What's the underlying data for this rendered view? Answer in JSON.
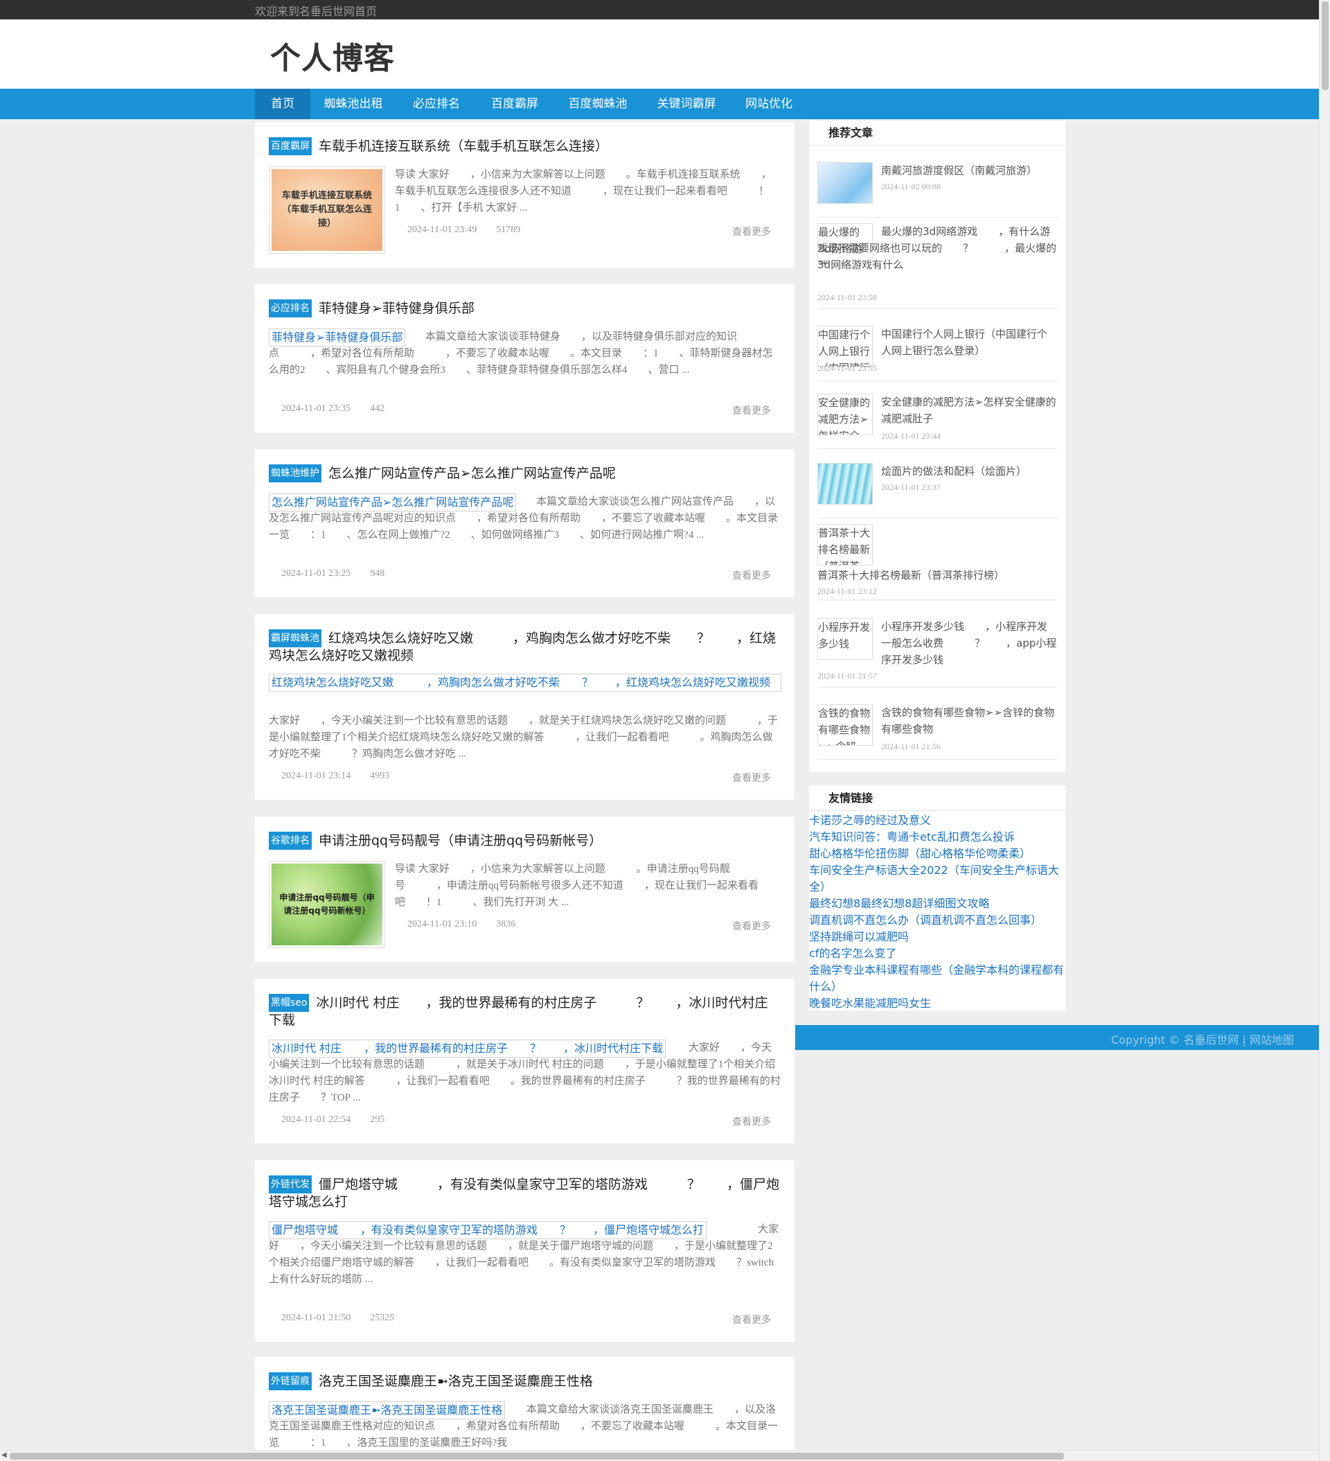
{
  "topbar": {
    "welcome": "欢迎来到名垂后世网首页"
  },
  "header": {
    "site_title": "个人博客"
  },
  "nav": [
    "首页",
    "蜘蛛池出租",
    "必应排名",
    "百度霸屏",
    "百度蜘蛛池",
    "关键词霸屏",
    "网站优化"
  ],
  "more_label": "查看更多",
  "posts": [
    {
      "category": "百度霸屏",
      "title": "车载手机连接互联系统（车载手机互联怎么连接）",
      "thumb_text": "车载手机连接互联系统（车载手机互联怎么连接）",
      "excerpt": "导读 大家好　　，小信来为大家解答以上问题　　。车载手机连接互联系统　　，车载手机互联怎么连接很多人还不知道　　　，现在让我们一起来看看吧　　　！1　　、打开【手机 大家好 ...",
      "date": "2024-11-01 23:49",
      "views": "51789"
    },
    {
      "category": "必应排名",
      "title": "菲特健身➢菲特健身俱乐部",
      "alt": "菲特健身➢菲特健身俱乐部",
      "excerpt": "本篇文章给大家谈谈菲特健身　　，以及菲特健身俱乐部对应的知识点　　　，希望对各位有所帮助　　　，不要忘了收藏本站喔　　。本文目录　　：1　　、菲特斯健身器材怎么用的2　　、宾阳县有几个健身会所3　　、菲特健身菲特健身俱乐部怎么样4　　、营口 ...",
      "date": "2024-11-01 23:35",
      "views": "442"
    },
    {
      "category": "蜘蛛池维护",
      "title": "怎么推广网站宣传产品➢怎么推广网站宣传产品呢",
      "alt": "怎么推广网站宣传产品➢怎么推广网站宣传产品呢",
      "excerpt": "本篇文章给大家谈谈怎么推广网站宣传产品　　，以及怎么推广网站宣传产品呢对应的知识点　　，希望对各位有所帮助　　，不要忘了收藏本站喔　　。本文目录一览　　：1　　、怎么在网上做推广?2　　、如何做网络推广3　　、如何进行网站推广啊?4 ...",
      "date": "2024-11-01 23:25",
      "views": "948"
    },
    {
      "category": "霸屏蜘蛛池",
      "title": "红烧鸡块怎么烧好吃又嫩　　　，鸡胸肉怎么做才好吃不柴　　？　　，红烧鸡块怎么烧好吃又嫩视频",
      "alt": "红烧鸡块怎么烧好吃又嫩　　　，鸡胸肉怎么做才好吃不柴　　？　　，红烧鸡块怎么烧好吃又嫩视频",
      "excerpt": "大家好　　，今天小编关注到一个比较有意思的话题　　，就是关于红烧鸡块怎么烧好吃又嫩的问题　　　，于是小编就整理了1个相关介绍红烧鸡块怎么烧好吃又嫩的解答　　　，让我们一起看看吧　　　。鸡胸肉怎么做才好吃不柴　　　？鸡胸肉怎么做才好吃 ...",
      "date": "2024-11-01 23:14",
      "views": "4993"
    },
    {
      "category": "谷歌排名",
      "title": "申请注册qq号码靓号（申请注册qq号码新帐号）",
      "thumb_text": "申请注册qq号码靓号（申请注册qq号码新帐号）",
      "excerpt": "导读 大家好　　，小信来为大家解答以上问题　　　。申请注册qq号码靓号　　　，申请注册qq号码新帐号很多人还不知道　　，现在让我们一起来看看吧　　！1　　　、我们先打开浏 大 ...",
      "date": "2024-11-01 23:10",
      "views": "3836"
    },
    {
      "category": "黑帽seo",
      "title": "冰川时代 村庄　　，我的世界最稀有的村庄房子　　　？　　，冰川时代村庄下载",
      "alt": "冰川时代 村庄　　，我的世界最稀有的村庄房子　　？　　，冰川时代村庄下载",
      "excerpt": "大家好　　，今天小编关注到一个比较有意思的话题　　　，就是关于冰川时代 村庄的问题　　，于是小编就整理了1个相关介绍冰川时代 村庄的解答　　　，让我们一起看看吧　　。我的世界最稀有的村庄房子　　　？我的世界最稀有的村庄房子　　？TOP ...",
      "date": "2024-11-01 22:54",
      "views": "295"
    },
    {
      "category": "外链代发",
      "title": "僵尸炮塔守城　　　，有没有类似皇家守卫军的塔防游戏　　　？　　，僵尸炮塔守城怎么打",
      "alt": "僵尸炮塔守城　　，有没有类似皇家守卫军的塔防游戏　　？　　，僵尸炮塔守城怎么打",
      "excerpt": "大家好　　，今天小编关注到一个比较有意思的话题　　，就是关于僵尸炮塔守城的问题　　，于是小编就整理了2个相关介绍僵尸炮塔守城的解答　　，让我们一起看看吧　　。有没有类似皇家守卫军的塔防游戏　　？switch上有什么好玩的塔防 ...",
      "date": "2024-11-01 21:50",
      "views": "25325"
    },
    {
      "category": "外链留痕",
      "title": "洛克王国圣诞麋鹿王➼洛克王国圣诞麋鹿王性格",
      "alt": "洛克王国圣诞麋鹿王➼洛克王国圣诞麋鹿王性格",
      "excerpt": "本篇文章给大家谈谈洛克王国圣诞麋鹿王　　，以及洛克王国圣诞麋鹿王性格对应的知识点　　，希望对各位有所帮助　　，不要忘了收藏本站喔　　　。本文目录一览　　　：1　　、洛克王国里的圣诞麋鹿王好吗?我"
    }
  ],
  "sidebar": {
    "recommended_title": "推荐文章",
    "recommended": [
      {
        "title": "南戴河旅游度假区（南戴河旅游）",
        "date": "2024-11-02 00:08"
      },
      {
        "title": "最火爆的3d网络游戏　　，有什么游戏是不需要网络也可以玩的　　？　　　，最火爆的3d网络游戏有什么",
        "alt": "最火爆的3d网络游戏",
        "date": "2024-11-01 23:58"
      },
      {
        "title": "中国建行个人网上银行（中国建行个人网上银行怎么登录）",
        "alt": "中国建行个人网上银行（中国建行",
        "date": "2024-11-01 23:55"
      },
      {
        "title": "安全健康的减肥方法➢怎样安全健康的减肥减肚子",
        "alt": "安全健康的减肥方法➢怎样安全",
        "date": "2024-11-01 23:44"
      },
      {
        "title": "烩面片的做法和配料（烩面片）",
        "date": "2024-11-01 23:37"
      },
      {
        "title": "普洱茶十大排名榜最新（普洱茶排行榜）",
        "alt": "普洱茶十大排名榜最新（普洱茶",
        "date": "2024-11-01 23:12"
      },
      {
        "title": "小程序开发多少钱　　，小程序开发一般怎么收费　　　？　　，app小程序开发多少钱",
        "alt": "小程序开发多少钱",
        "date": "2024-11-01 21:57"
      },
      {
        "title": "含铁的食物有哪些食物➢➢含锌的食物有哪些食物",
        "alt": "含铁的食物有哪些食物➢➢含锌",
        "date": "2024-11-01 21:56"
      }
    ],
    "links_title": "友情链接",
    "links": [
      "卡诺莎之辱的经过及意义",
      "汽车知识问答：粤通卡etc乱扣费怎么投诉",
      "甜心格格华伦扭伤脚（甜心格格华伦吻柔柔）",
      "车间安全生产标语大全2022（车间安全生产标语大全）",
      "最终幻想8最终幻想8超详细图文攻略",
      "调直机调不直怎么办（调直机调不直怎么回事）",
      "坚持跳绳可以减肥吗",
      "cf的名字怎么变了",
      "金融学专业本科课程有哪些（金融学本科的课程都有什么）",
      "晚餐吃水果能减肥吗女生"
    ]
  },
  "footer": {
    "copyright": "Copyright © 名垂后世网 | 网站地图"
  },
  "colors": {
    "brand_blue": "#1a92d6",
    "nav_active": "#1379b9",
    "link_blue": "#1a72c6",
    "topbar": "#303030"
  }
}
